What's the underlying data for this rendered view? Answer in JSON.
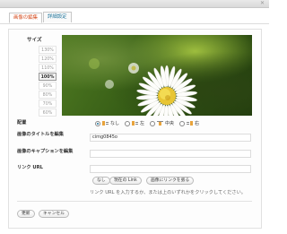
{
  "tabs": [
    {
      "label": "画像の編集",
      "active": true
    },
    {
      "label": "詳細設定",
      "active": false
    }
  ],
  "close_icon": "close-x-icon",
  "size": {
    "label": "サイズ",
    "options": [
      "130%",
      "120%",
      "110%",
      "100%",
      "90%",
      "80%",
      "70%",
      "60%"
    ],
    "selected": "100%"
  },
  "preview_image": "daisy-flower-photo",
  "alignment": {
    "label": "配置",
    "options": [
      {
        "label": "なし",
        "checked": true
      },
      {
        "label": "左",
        "checked": false
      },
      {
        "label": "中央",
        "checked": false
      },
      {
        "label": "右",
        "checked": false
      }
    ]
  },
  "title_field": {
    "label": "画像のタイトルを編集",
    "value": "cimg0845o"
  },
  "caption_field": {
    "label": "画像のキャプションを編集",
    "value": ""
  },
  "link_field": {
    "label": "リンク URL",
    "value": ""
  },
  "link_buttons": {
    "none": "なし",
    "current": "現在の Link",
    "image": "画像にリンクを張る"
  },
  "link_hint": "リンク URL を入力するか、または上のいずれかをクリックしてください。",
  "actions": {
    "update": "更新",
    "cancel": "キャンセル"
  },
  "colors": {
    "accent": "#d54e21",
    "link": "#21759b",
    "align_icon": "#e8a33b"
  }
}
